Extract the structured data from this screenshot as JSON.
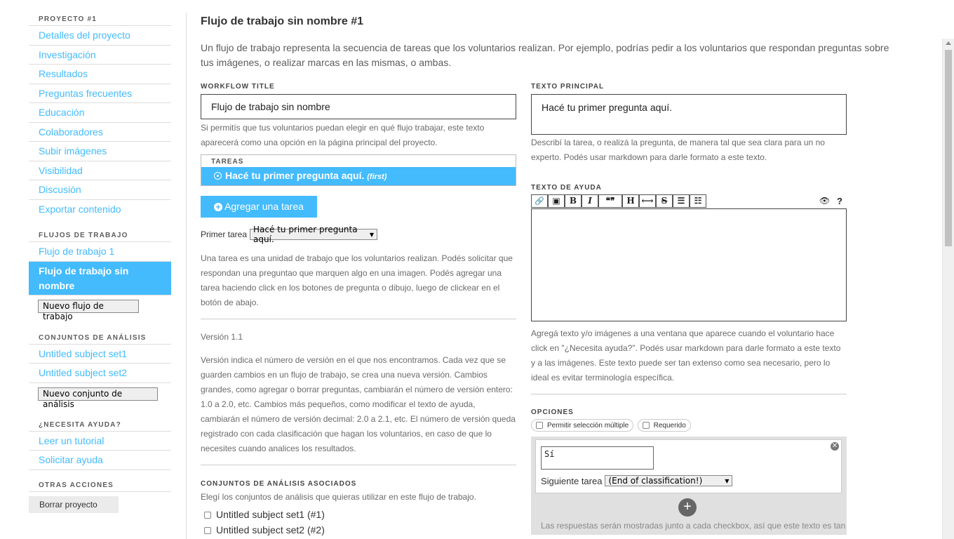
{
  "sidebar": {
    "project_heading": "PROYECTO #1",
    "project_items": [
      {
        "label": "Detalles del proyecto"
      },
      {
        "label": "Investigación"
      },
      {
        "label": "Resultados"
      },
      {
        "label": "Preguntas frecuentes"
      },
      {
        "label": "Educación"
      },
      {
        "label": "Colaboradores"
      },
      {
        "label": "Subir imágenes"
      },
      {
        "label": "Visibilidad"
      },
      {
        "label": "Discusión"
      },
      {
        "label": "Exportar contenido"
      }
    ],
    "workflows_heading": "FLUJOS DE TRABAJO",
    "workflows": [
      {
        "label": "Flujo de trabajo 1"
      },
      {
        "label": "Flujo de trabajo sin nombre"
      }
    ],
    "new_workflow_button": "Nuevo flujo de trabajo",
    "subject_sets_heading": "CONJUNTOS DE ANÁLISIS",
    "subject_sets": [
      {
        "label": "Untitled subject set1"
      },
      {
        "label": "Untitled subject set2"
      }
    ],
    "new_subject_set_button": "Nuevo conjunto de análisis",
    "help_heading": "¿NECESITA AYUDA?",
    "help_items": [
      {
        "label": "Leer un tutorial"
      },
      {
        "label": "Solicitar ayuda"
      }
    ],
    "other_heading": "OTRAS ACCIONES",
    "delete_project_button": "Borrar proyecto"
  },
  "main": {
    "title": "Flujo de trabajo sin nombre #1",
    "intro": "Un flujo de trabajo representa la secuencia de tareas que los voluntarios realizan. Por ejemplo, podrías pedir a los voluntarios que respondan preguntas sobre tus imágenes, o realizar marcas en las mismas, o ambas.",
    "workflow_title_label": "WORKFLOW TITLE",
    "workflow_title_value": "Flujo de trabajo sin nombre",
    "workflow_title_help": "Si permitís que tus voluntarios puedan elegir en qué flujo trabajar, este texto aparecerá como una opción en la página principal del proyecto.",
    "tasks_heading": "TAREAS",
    "task_label": "Hacé tu primer pregunta aquí.",
    "task_first_tag": "(first)",
    "add_task_button": "Agregar una tarea",
    "first_task_label": "Primer tarea",
    "first_task_value": "Hacé tu primer pregunta aquí.",
    "task_help": "Una tarea es una unidad de trabajo que los voluntarios realizan. Podés solicitar que respondan una preguntao que marquen algo en una imagen. Podés agregar una tarea haciendo click en los botones de pregunta o dibujo, luego de clickear en el botón de abajo.",
    "version_label": "Versión 1.1",
    "version_help": "Versión indica el número de versión en el que nos encontramos. Cada vez que se guarden cambios en un flujo de trabajo, se crea una nueva versión. Cambios grandes, como agregar o borrar preguntas, cambiarán el número de versión entero: 1.0 a 2.0, etc. Cambios más pequeños, como modificar el texto de ayuda, cambiarán el número de versión decimal: 2.0 a 2.1, etc. El número de versión queda registrado con cada clasificación que hagan los voluntarios, en caso de que lo necesites cuando analices los resultados.",
    "assoc_sets_label": "CONJUNTOS DE ANÁLISIS ASOCIADOS",
    "assoc_sets_help": "Elegí los conjuntos de análisis que quieras utilizar en este flujo de trabajo.",
    "assoc_sets": [
      {
        "label": "Untitled subject set1 (#1)"
      },
      {
        "label": "Untitled subject set2 (#2)"
      }
    ]
  },
  "task_editor": {
    "main_text_label": "TEXTO PRINCIPAL",
    "main_text_value": "Hacé tu primer pregunta aquí.",
    "main_text_help": "Describí la tarea, o realizá la pregunta, de manera tal que sea clara para un no experto. Podés usar markdown para darle formato a este texto.",
    "help_text_label": "TEXTO DE AYUDA",
    "help_text_help": "Agregá texto y/o imágenes a una ventana que aparece cuando el voluntario hace click en \"¿Necesita ayuda?\". Podés usar markdown para darle formato a este texto y a las imágenes. Este texto puede ser tan extenso como sea necesario, pero lo ideal es evitar terminología específica.",
    "toolbar": [
      {
        "icon": "link-icon",
        "glyph": "🔗"
      },
      {
        "icon": "image-icon",
        "glyph": "▣"
      },
      {
        "icon": "bold-icon",
        "glyph": "B"
      },
      {
        "icon": "italic-icon",
        "glyph": "I"
      },
      {
        "icon": "quote-icon",
        "glyph": "❝❞"
      },
      {
        "icon": "heading-icon",
        "glyph": "H"
      },
      {
        "icon": "horizontal-rule-icon",
        "glyph": "⟷"
      },
      {
        "icon": "strikethrough-icon",
        "glyph": "S"
      },
      {
        "icon": "bullet-list-icon",
        "glyph": "☰"
      },
      {
        "icon": "numbered-list-icon",
        "glyph": "☷"
      }
    ],
    "preview_icon": "👁",
    "help_icon": "?",
    "options_label": "OPCIONES",
    "option_multiple": "Permitir selección múltiple",
    "option_required": "Requerido",
    "answer_value": "Sí",
    "next_task_label": "Siguiente tarea",
    "next_task_value": "(End of classification!)",
    "answers_note": "Las respuestas serán mostradas junto a cada checkbox, así que este texto es tan"
  },
  "colors": {
    "accent": "#43bbfd"
  }
}
